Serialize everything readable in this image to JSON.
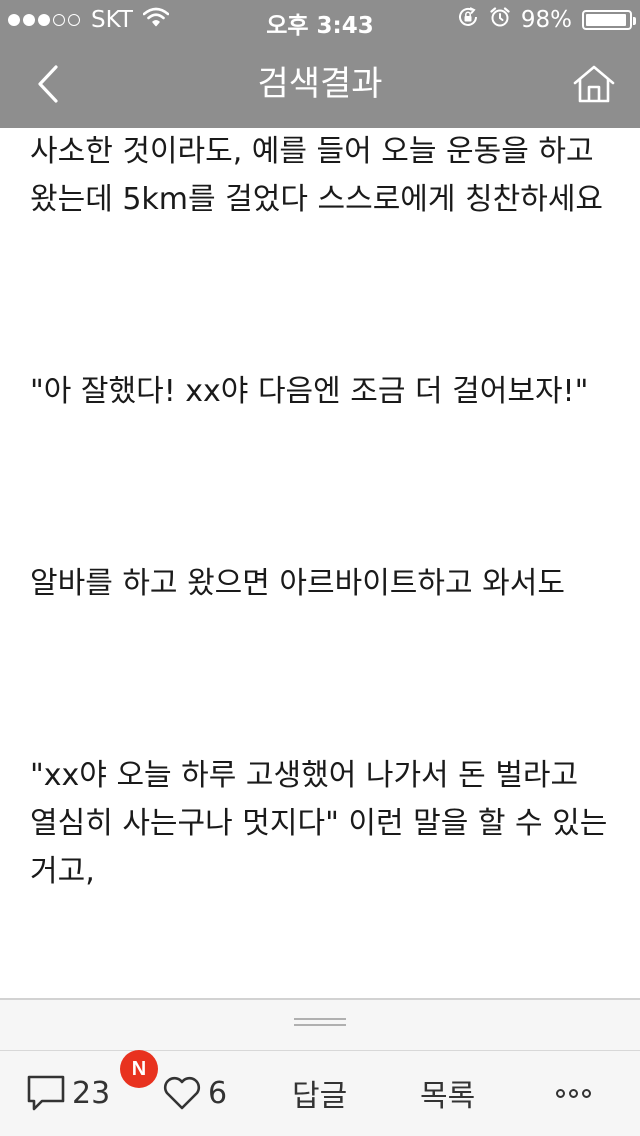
{
  "status_bar": {
    "carrier": "SKT",
    "time": "오후 3:43",
    "battery": "98%",
    "battery_level": 0.98
  },
  "nav": {
    "title": "검색결과",
    "back_icon": "chevron-left-icon",
    "home_icon": "home-icon"
  },
  "content": {
    "paragraphs": [
      "사소한 것이라도, 예를 들어 오늘 운동을 하고 왔는데 5km를 걸었다 스스로에게 칭찬하세요",
      "\"아 잘했다! xx야 다음엔 조금 더 걸어보자!\"",
      "알바를 하고 왔으면 아르바이트하고 와서도",
      "\"xx야 오늘 하루 고생했어 나가서 돈 벌라고 열심히 사는구나 멋지다\" 이런 말을 할 수 있는 거고,"
    ]
  },
  "toolbar": {
    "comments_count": "23",
    "new_badge": "N",
    "likes_count": "6",
    "reply_label": "답글",
    "list_label": "목록"
  }
}
